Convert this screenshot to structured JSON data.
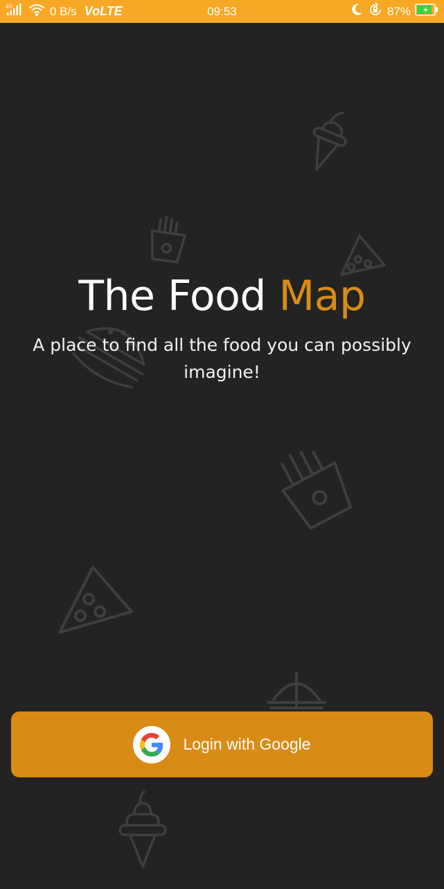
{
  "status_bar": {
    "network": "4G",
    "speed": "0 B/s",
    "volte": "VoLTE",
    "time": "09:53",
    "battery_percent": "87%",
    "battery_level": 0.87,
    "icons": [
      "signal-icon",
      "wifi-icon",
      "moon-icon",
      "lock-rotation-icon",
      "battery-icon"
    ]
  },
  "hero": {
    "title_main": "The Food",
    "title_accent": "Map",
    "subtitle": "A place to find all the food you can possibly imagine!"
  },
  "login": {
    "label": "Login with Google",
    "icon": "google-icon"
  },
  "background_icons": [
    "ice-cream-icon",
    "fries-icon",
    "pizza-slice-icon",
    "burger-icon",
    "fries-icon",
    "pizza-slice-icon",
    "cloche-icon",
    "ice-cream-icon"
  ],
  "colors": {
    "status_bar": "#f7a825",
    "background": "#232323",
    "accent": "#d98c16",
    "button": "#d88b15",
    "doodle": "#3e3e3e"
  }
}
